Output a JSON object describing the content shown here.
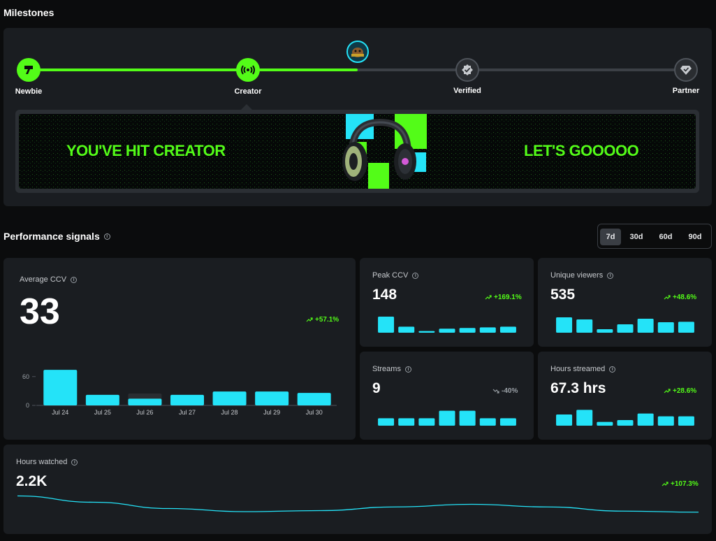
{
  "milestones": {
    "title": "Milestones",
    "steps": [
      {
        "label": "Newbie",
        "status": "done",
        "icon": "kick-logo-icon"
      },
      {
        "label": "Creator",
        "status": "done",
        "icon": "broadcast-icon"
      },
      {
        "label": "Verified",
        "status": "todo",
        "icon": "verified-badge-icon"
      },
      {
        "label": "Partner",
        "status": "todo",
        "icon": "partner-diamond-icon"
      }
    ],
    "progress": 0.52,
    "banner": {
      "left_text": "YOU'VE HIT CREATOR",
      "right_text": "LET'S GOOOOO"
    }
  },
  "performance": {
    "title": "Performance signals",
    "periods": [
      "7d",
      "30d",
      "60d",
      "90d"
    ],
    "selected_period": "7d"
  },
  "stats": {
    "avg_ccv": {
      "label": "Average CCV",
      "value": "33",
      "trend": "+57.1%",
      "direction": "up"
    },
    "peak_ccv": {
      "label": "Peak CCV",
      "value": "148",
      "trend": "+169.1%",
      "direction": "up"
    },
    "unique_viewers": {
      "label": "Unique viewers",
      "value": "535",
      "trend": "+48.6%",
      "direction": "up"
    },
    "streams": {
      "label": "Streams",
      "value": "9",
      "trend": "-40%",
      "direction": "down"
    },
    "hours_streamed": {
      "label": "Hours streamed",
      "value": "67.3 hrs",
      "trend": "+28.6%",
      "direction": "up"
    },
    "hours_watched": {
      "label": "Hours watched",
      "value": "2.2K",
      "trend": "+107.3%",
      "direction": "up"
    }
  },
  "chart_data": [
    {
      "type": "bar",
      "categories": [
        "Jul 24",
        "Jul 25",
        "Jul 26",
        "Jul 27",
        "Jul 28",
        "Jul 29",
        "Jul 30"
      ],
      "values": [
        74,
        22,
        14,
        22,
        29,
        29,
        26
      ],
      "yticks": [
        "60",
        "0"
      ],
      "ylim": [
        0,
        80
      ]
    },
    {
      "type": "bar",
      "values": [
        48,
        18,
        5,
        12,
        14,
        16,
        18
      ],
      "ylim": [
        0,
        50
      ]
    },
    {
      "type": "bar",
      "values": [
        110,
        95,
        25,
        60,
        100,
        75,
        78
      ],
      "ylim": [
        0,
        120
      ]
    },
    {
      "type": "bar",
      "values": [
        2,
        2,
        2,
        4,
        4,
        2,
        2
      ],
      "ylim": [
        0,
        4.5
      ]
    },
    {
      "type": "bar",
      "values": [
        12,
        17,
        4,
        6,
        13,
        10,
        10
      ],
      "ylim": [
        0,
        18
      ]
    },
    {
      "type": "line",
      "values": [
        540,
        420,
        300,
        240,
        260,
        330,
        380,
        330,
        250,
        230
      ],
      "ylim": [
        0,
        600
      ]
    }
  ],
  "colors": {
    "accent_green": "#53fc18",
    "bar_cyan": "#24e3f8",
    "card_bg": "#1a1d21"
  }
}
